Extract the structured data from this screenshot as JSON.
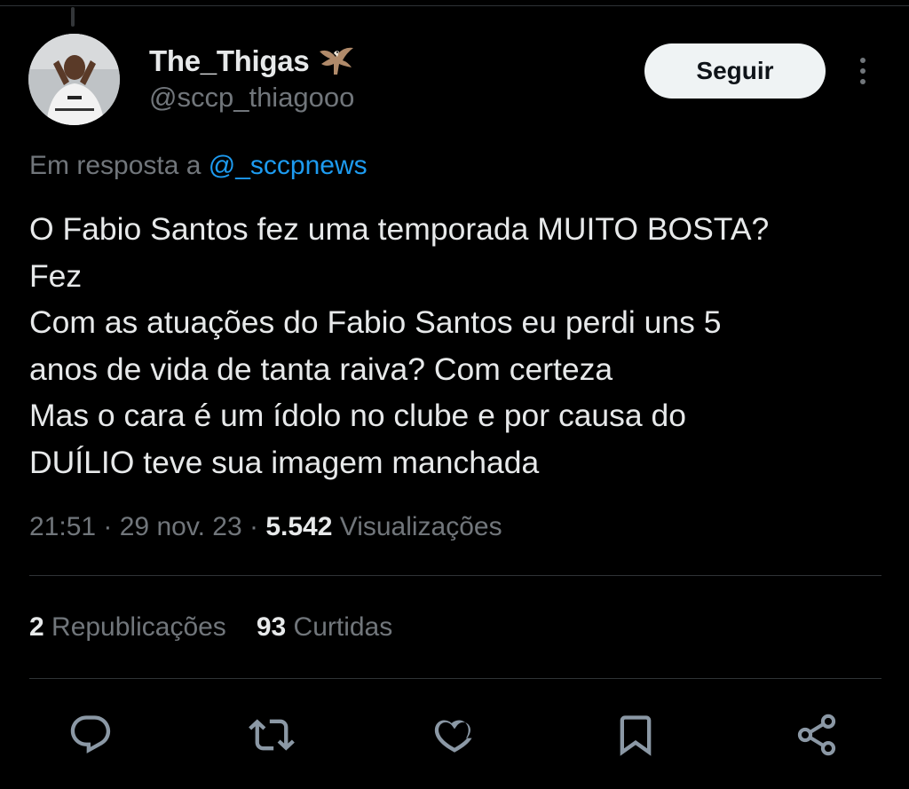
{
  "author": {
    "display_name": "The_Thigas",
    "handle": "@sccp_thiagooo",
    "badge_icon": "eagle-icon"
  },
  "follow_button_label": "Seguir",
  "reply_context": {
    "prefix": "Em resposta a ",
    "mention": "@_sccpnews"
  },
  "tweet_lines": [
    "O Fabio Santos fez uma temporada MUITO BOSTA?",
    "Fez",
    "Com as atuações do Fabio Santos eu perdi uns 5",
    "anos de vida de tanta raiva? Com certeza",
    "Mas o cara é um ídolo no clube e por causa do",
    "DUÍLIO teve sua imagem manchada"
  ],
  "meta": {
    "time": "21:51",
    "separator": " · ",
    "date": "29 nov. 23",
    "views_count": "5.542",
    "views_label": " Visualizações"
  },
  "stats": {
    "reposts_count": "2",
    "reposts_label": " Republicações",
    "likes_count": "93",
    "likes_label": " Curtidas"
  },
  "actions": [
    "reply-icon",
    "repost-icon",
    "like-icon",
    "bookmark-icon",
    "share-icon"
  ],
  "colors": {
    "background": "#000000",
    "text": "#e7e9ea",
    "secondary": "#71767b",
    "link": "#1d9bf0",
    "divider": "#2f3336",
    "button_bg": "#eff3f4"
  }
}
